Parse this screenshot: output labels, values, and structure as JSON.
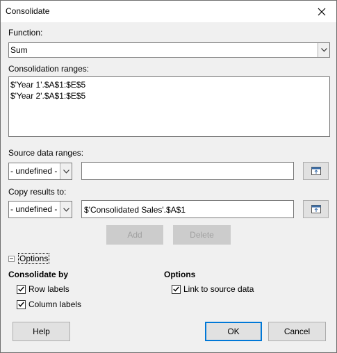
{
  "window": {
    "title": "Consolidate"
  },
  "function": {
    "label": "Function:",
    "value": "Sum"
  },
  "consolidation_ranges": {
    "label": "Consolidation ranges:",
    "items": [
      "$'Year 1'.$A$1:$E$5",
      "$'Year 2'.$A$1:$E$5"
    ]
  },
  "source_data_ranges": {
    "label": "Source data ranges:",
    "combo_value": "- undefined -",
    "input_value": ""
  },
  "copy_results_to": {
    "label": "Copy results to:",
    "combo_value": "- undefined -",
    "input_value": "$'Consolidated Sales'.$A$1"
  },
  "buttons": {
    "add": "Add",
    "delete": "Delete",
    "help": "Help",
    "ok": "OK",
    "cancel": "Cancel"
  },
  "options_expander": {
    "label": "Options"
  },
  "consolidate_by": {
    "heading": "Consolidate by",
    "row_labels": {
      "label": "Row labels",
      "checked": true
    },
    "column_labels": {
      "label": "Column labels",
      "checked": true
    }
  },
  "options": {
    "heading": "Options",
    "link_to_source": {
      "label": "Link to source data",
      "checked": true
    }
  }
}
